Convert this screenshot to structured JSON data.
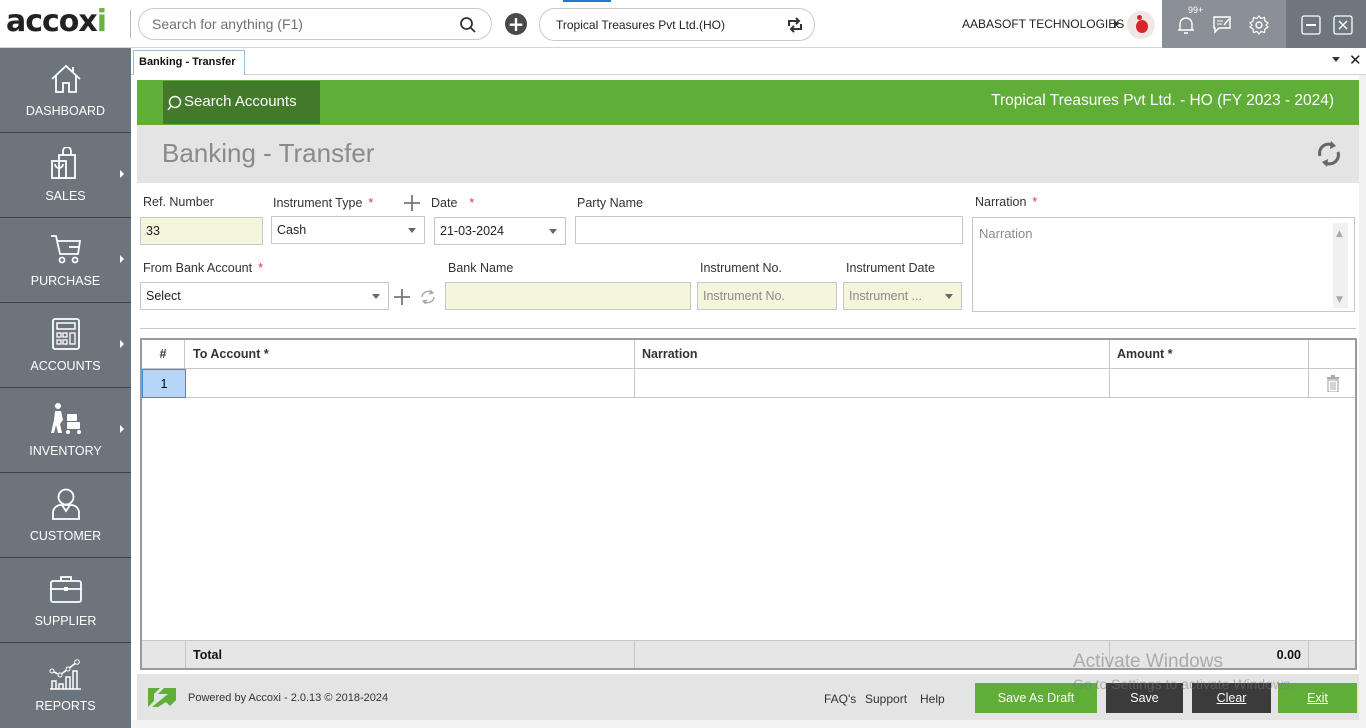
{
  "app": {
    "logo": "accoxi",
    "search_placeholder": "Search for anything (F1)",
    "company_selector": "Tropical Treasures Pvt Ltd.(HO)",
    "organization": "AABASOFT TECHNOLOGIES",
    "notifications_badge": "99+"
  },
  "sidebar": {
    "items": [
      {
        "label": "DASHBOARD",
        "icon": "home-icon",
        "has_submenu": false
      },
      {
        "label": "SALES",
        "icon": "shopping-bag-icon",
        "has_submenu": true
      },
      {
        "label": "PURCHASE",
        "icon": "cart-icon",
        "has_submenu": true
      },
      {
        "label": "ACCOUNTS",
        "icon": "calculator-icon",
        "has_submenu": true
      },
      {
        "label": "INVENTORY",
        "icon": "trolley-icon",
        "has_submenu": true
      },
      {
        "label": "CUSTOMER",
        "icon": "user-icon",
        "has_submenu": false
      },
      {
        "label": "SUPPLIER",
        "icon": "briefcase-icon",
        "has_submenu": false
      },
      {
        "label": "REPORTS",
        "icon": "chart-icon",
        "has_submenu": false
      }
    ]
  },
  "tabs": [
    {
      "label": "Banking - Transfer",
      "active": true
    }
  ],
  "header": {
    "search_accounts": "Search Accounts",
    "company_fy": "Tropical Treasures Pvt Ltd. - HO (FY 2023 - 2024)",
    "page_title": "Banking - Transfer"
  },
  "form": {
    "ref_number": {
      "label": "Ref. Number",
      "value": "33"
    },
    "instrument_type": {
      "label": "Instrument Type",
      "required": "*",
      "value": "Cash"
    },
    "date": {
      "label": "Date",
      "required": "*",
      "value": "21-03-2024"
    },
    "party_name": {
      "label": "Party Name",
      "value": ""
    },
    "narration": {
      "label": "Narration",
      "required": "*",
      "placeholder": "Narration"
    },
    "from_bank_account": {
      "label": "From Bank Account",
      "required": "*",
      "value": "Select"
    },
    "bank_name": {
      "label": "Bank Name",
      "value": ""
    },
    "instrument_no": {
      "label": "Instrument No.",
      "placeholder": "Instrument No."
    },
    "instrument_date": {
      "label": "Instrument Date",
      "placeholder": "Instrument ..."
    }
  },
  "grid": {
    "columns": [
      "#",
      "To Account *",
      "Narration",
      "Amount *"
    ],
    "rows": [
      {
        "num": "1",
        "to_account": "",
        "narration": "",
        "amount": ""
      }
    ],
    "total_label": "Total",
    "total_amount": "0.00"
  },
  "footer": {
    "powered_by": "Powered by Accoxi - 2.0.13 © 2018-2024",
    "links": [
      "FAQ's",
      "Support",
      "Help"
    ],
    "buttons": {
      "save_draft": "Save As Draft",
      "save": "Save",
      "clear": "Clear",
      "exit": "Exit"
    }
  },
  "watermark": {
    "line1": "Activate Windows",
    "line2": "Go to Settings to activate Windows."
  },
  "colors": {
    "brand_green": "#60ae38",
    "dark_green": "#43792a",
    "sidebar_bg": "#6d757c",
    "readonly_field": "#f5f5dc"
  }
}
